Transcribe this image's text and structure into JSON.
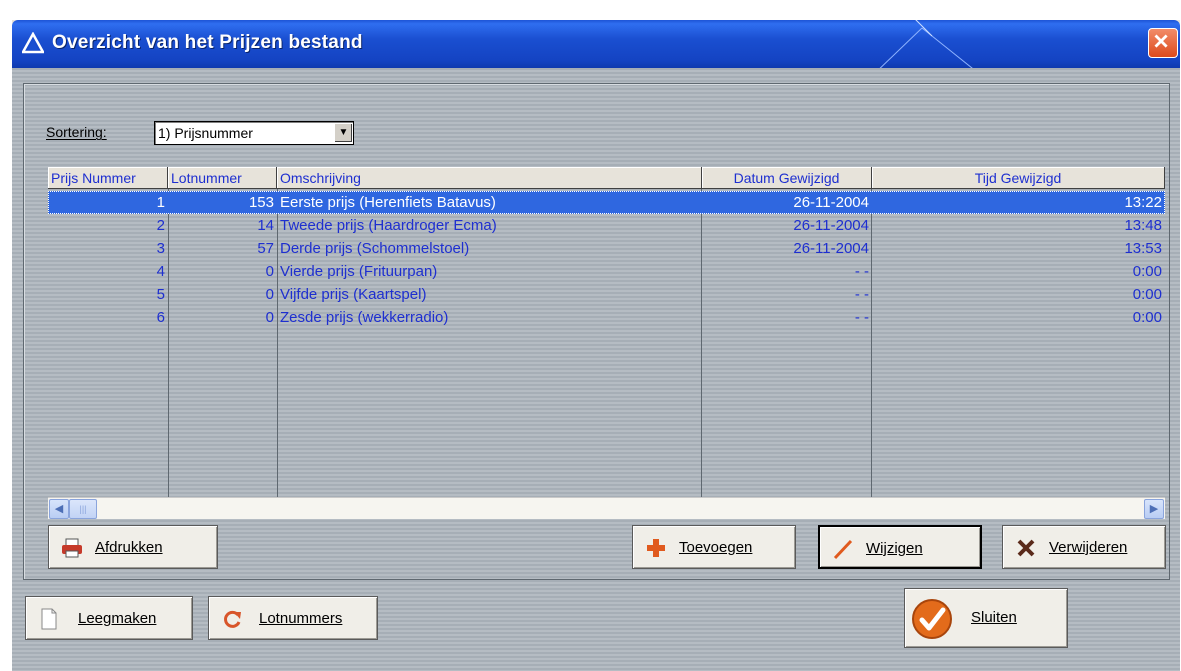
{
  "window": {
    "title": "Overzicht van het Prijzen bestand"
  },
  "sort": {
    "label": "Sortering:",
    "selected": "1) Prijsnummer"
  },
  "grid": {
    "columns": [
      "Prijs Nummer",
      "Lotnummer",
      "Omschrijving",
      "Datum Gewijzigd",
      "Tijd Gewijzigd"
    ],
    "rows": [
      {
        "nr": "1",
        "lot": "153",
        "desc": "Eerste prijs (Herenfiets Batavus)",
        "date": "26-11-2004",
        "time": "13:22"
      },
      {
        "nr": "2",
        "lot": "14",
        "desc": "Tweede prijs (Haardroger Ecma)",
        "date": "26-11-2004",
        "time": "13:48"
      },
      {
        "nr": "3",
        "lot": "57",
        "desc": "Derde prijs (Schommelstoel)",
        "date": "26-11-2004",
        "time": "13:53"
      },
      {
        "nr": "4",
        "lot": "0",
        "desc": "Vierde prijs (Frituurpan)",
        "date": "- -",
        "time": "0:00"
      },
      {
        "nr": "5",
        "lot": "0",
        "desc": "Vijfde prijs (Kaartspel)",
        "date": "- -",
        "time": "0:00"
      },
      {
        "nr": "6",
        "lot": "0",
        "desc": "Zesde prijs (wekkerradio)",
        "date": "- -",
        "time": "0:00"
      }
    ],
    "selected_row": 0
  },
  "buttons": {
    "afdrukken": "Afdrukken",
    "toevoegen": "Toevoegen",
    "wijzigen": "Wijzigen",
    "verwijderen": "Verwijderen",
    "leegmaken": "Leegmaken",
    "lotnummers": "Lotnummers",
    "sluiten": "Sluiten"
  },
  "icons": {
    "title": "triangle-icon",
    "close": "close-icon",
    "print": "printer-icon",
    "add": "plus-icon",
    "edit": "pencil-icon",
    "delete": "x-icon",
    "clear": "document-icon",
    "numbers": "refresh-icon",
    "close_dialog": "checkmark-icon"
  },
  "colors": {
    "titlebar": "#1a4fd1",
    "selection": "#2f67e0",
    "text": "#1e2fd0",
    "close": "#dd4a1c"
  }
}
